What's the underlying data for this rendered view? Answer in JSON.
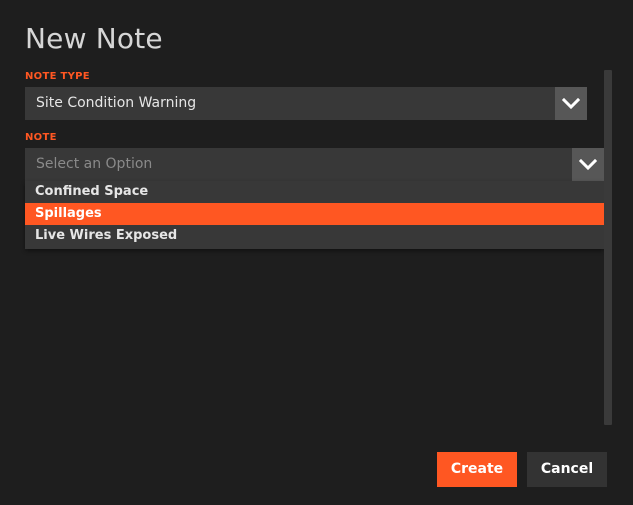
{
  "dialog": {
    "title": "New Note"
  },
  "note_type": {
    "label": "NOTE TYPE",
    "value": "Site Condition Warning"
  },
  "note": {
    "label": "NOTE",
    "placeholder": "Select an Option",
    "options": [
      {
        "label": "Confined Space",
        "selected": false
      },
      {
        "label": "Spillages",
        "selected": true
      },
      {
        "label": "Live Wires Exposed",
        "selected": false
      }
    ]
  },
  "buttons": {
    "create": "Create",
    "cancel": "Cancel"
  },
  "colors": {
    "accent": "#ff5722",
    "background": "#1e1e1e",
    "field": "#383838"
  },
  "icons": {
    "dropdown": "chevron-down-icon"
  }
}
